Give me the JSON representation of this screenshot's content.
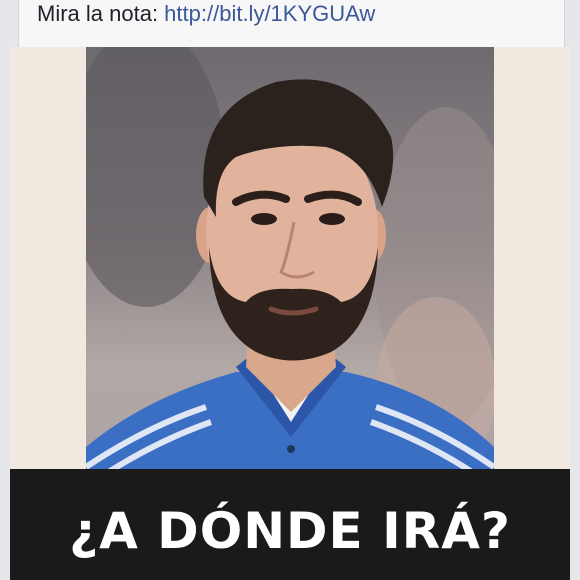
{
  "post": {
    "text_prefix": "Mira la nota: ",
    "link_text": "http://bit.ly/1KYGUAw",
    "link_color": "#3b5998"
  },
  "image": {
    "caption": "¿A DÓNDE IRÁ?",
    "description_icon": "player-portrait"
  },
  "colors": {
    "background": "#e6e7eb",
    "card": "#f7f7f7",
    "caption_band": "#1a1a1a",
    "jersey_blue": "#3b6fc4"
  }
}
